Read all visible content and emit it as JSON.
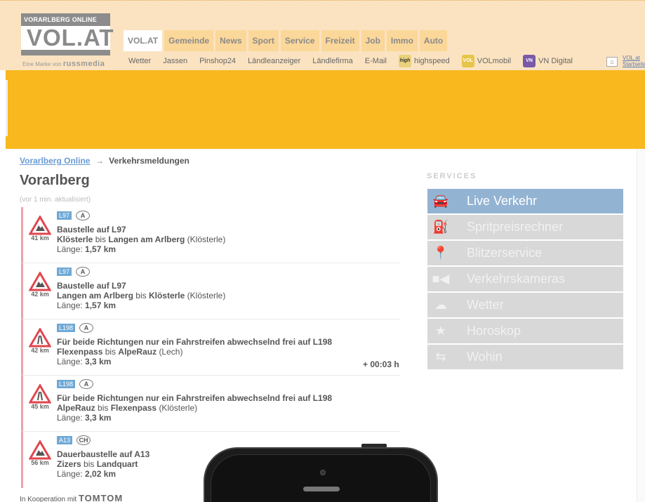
{
  "brand": {
    "logo_top": "VORARLBERG ONLINE",
    "logo_main": "VOL.AT",
    "tagline_prefix": "Eine Marke von",
    "tagline_brand": "russmedia"
  },
  "main_nav": [
    "VOL.AT",
    "Gemeinde",
    "News",
    "Sport",
    "Service",
    "Freizeit",
    "Job",
    "Immo",
    "Auto"
  ],
  "sub_nav": {
    "items": [
      "Wetter",
      "Jassen",
      "Pinshop24",
      "Ländleanzeiger",
      "Ländlefirma",
      "E-Mail"
    ],
    "highspeed_badge": "high",
    "highspeed": "highspeed",
    "volmobil_badge": "VOL",
    "volmobil": "VOLmobil",
    "vndigital_badge": "VN",
    "vndigital": "VN Digital",
    "home_link": "VOL.at Startseite"
  },
  "breadcrumb": {
    "root": "Vorarlberg Online",
    "arrow": "→",
    "current": "Verkehrsmeldungen"
  },
  "region_title": "Vorarlberg",
  "updated": "(vor 1 min. aktualisiert)",
  "messages": [
    {
      "km": "41 km",
      "road": "L97",
      "country": "A",
      "title": "Baustelle auf L97",
      "from": "Klösterle",
      "bis": "bis",
      "to": "Langen am Arlberg",
      "place": "(Klösterle)",
      "len_label": "Länge:",
      "len": "1,57 km",
      "delay": ""
    },
    {
      "km": "42 km",
      "road": "L97",
      "country": "A",
      "title": "Baustelle auf L97",
      "from": "Langen am Arlberg",
      "bis": "bis",
      "to": "Klösterle",
      "place": "(Klösterle)",
      "len_label": "Länge:",
      "len": "1,57 km",
      "delay": ""
    },
    {
      "km": "42 km",
      "road": "L198",
      "country": "A",
      "title": "Für beide Richtungen nur ein Fahrstreifen abwechselnd frei auf L198",
      "from": "Flexenpass",
      "bis": "bis",
      "to": "AlpeRauz",
      "place": "(Lech)",
      "len_label": "Länge:",
      "len": "3,3 km",
      "delay": "+ 00:03 h"
    },
    {
      "km": "45 km",
      "road": "L198",
      "country": "A",
      "title": "Für beide Richtungen nur ein Fahrstreifen abwechselnd frei auf L198",
      "from": "AlpeRauz",
      "bis": "bis",
      "to": "Flexenpass",
      "place": "(Klösterle)",
      "len_label": "Länge:",
      "len": "3,3 km",
      "delay": ""
    },
    {
      "km": "56 km",
      "road": "A13",
      "country": "CH",
      "title": "Dauerbaustelle auf A13",
      "from": "Zizers",
      "bis": "bis",
      "to": "Landquart",
      "place": "",
      "len_label": "Länge:",
      "len": "2,02 km",
      "delay": ""
    }
  ],
  "coop": {
    "prefix": "In Kooperation mit",
    "brand": "TOMTOM"
  },
  "services": {
    "heading": "SERVICES",
    "items": [
      {
        "label": "Live Verkehr",
        "icon": "car-icon"
      },
      {
        "label": "Spritpreisrechner",
        "icon": "fuel-icon"
      },
      {
        "label": "Blitzerservice",
        "icon": "map-pin-icon"
      },
      {
        "label": "Verkehrskameras",
        "icon": "camera-icon"
      },
      {
        "label": "Wetter",
        "icon": "weather-icon"
      },
      {
        "label": "Horoskop",
        "icon": "star-icon"
      },
      {
        "label": "Wohin",
        "icon": "signpost-icon"
      }
    ]
  },
  "colors": {
    "header_bg": "#fbe3c1",
    "banner": "#f8b81e",
    "service_active": "#93b3d3",
    "service_inactive": "#d8d8d8",
    "road_badge": "#6fa9d6"
  }
}
